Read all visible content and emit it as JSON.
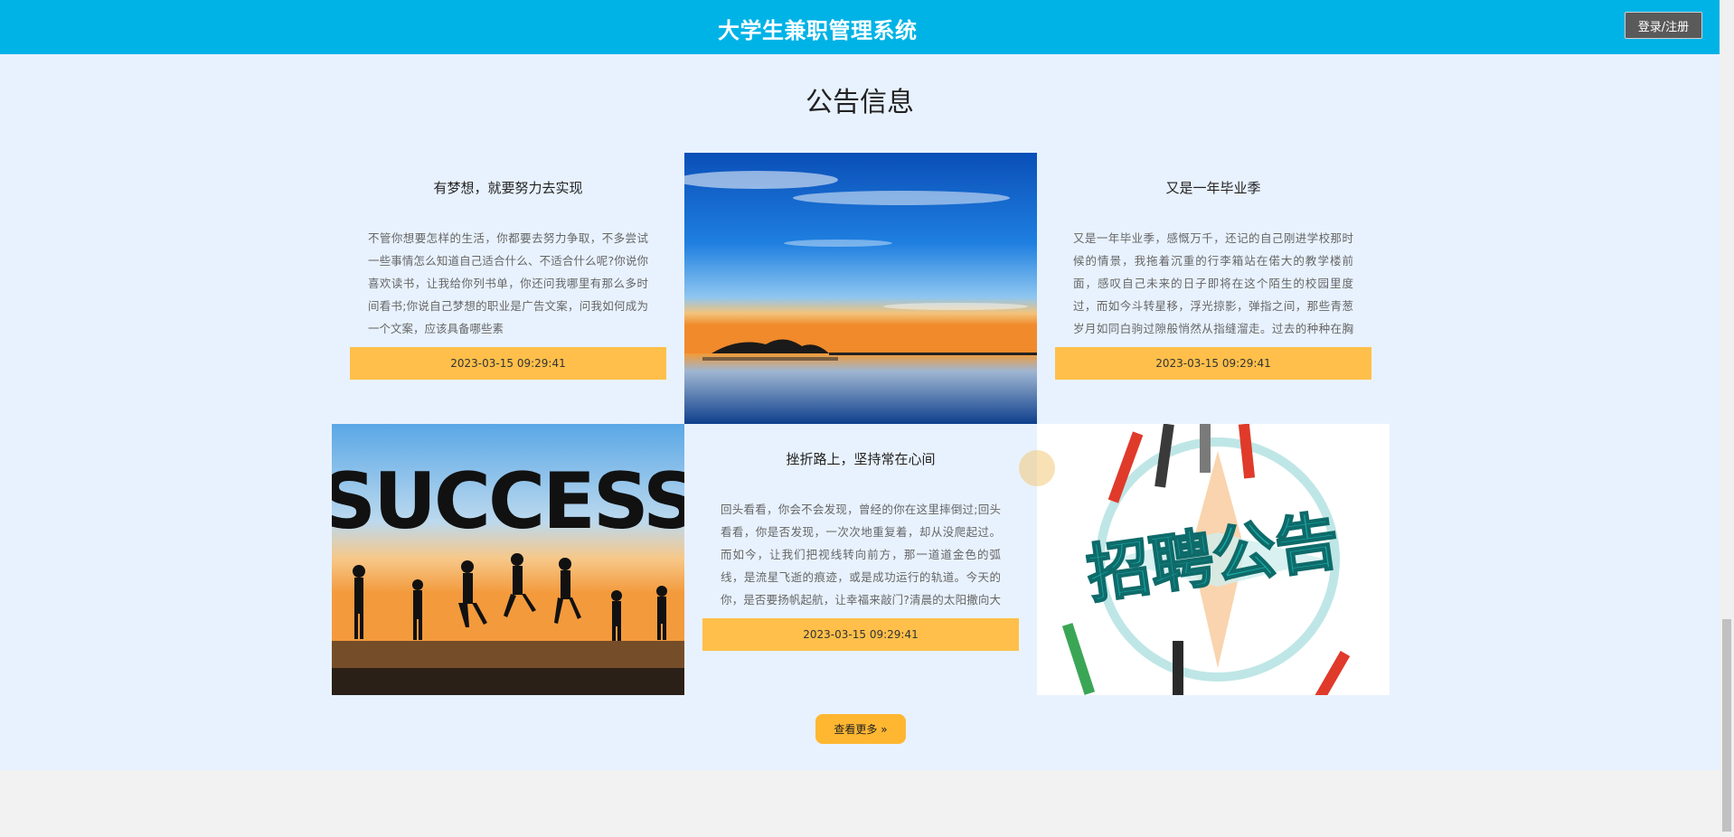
{
  "header": {
    "title": "大学生兼职管理系统",
    "login_label": "登录/注册"
  },
  "section": {
    "title": "公告信息",
    "more_label": "查看更多 »"
  },
  "cards": [
    {
      "title": "有梦想，就要努力去实现",
      "body": "不管你想要怎样的生活，你都要去努力争取，不多尝试一些事情怎么知道自己适合什么、不适合什么呢?你说你喜欢读书，让我给你列书单，你还问我哪里有那么多时间看书;你说自己梦想的职业是广告文案，问我如何成为一个文案，应该具备哪些素",
      "date": "2023-03-15 09:29:41"
    },
    {
      "title": "又是一年毕业季",
      "body": "又是一年毕业季，感慨万千，还记的自己刚进学校那时候的情景，我拖着沉重的行李箱站在偌大的教学楼前面，感叹自己未来的日子即将在这个陌生的校园里度过，而如今斗转星移，浮光掠影，弹指之间，那些青葱岁月如同白驹过隙般悄然从指缝溜走。过去的种种在胸口交集纠结，像",
      "date": "2023-03-15 09:29:41"
    },
    {
      "title": "挫折路上，坚持常在心间",
      "body": "回头看看，你会不会发现，曾经的你在这里摔倒过;回头看看，你是否发现，一次次地重复着，却从没爬起过。而如今，让我们把视线转向前方，那一道道金色的弧线，是流星飞逝的痕迹，或是成功运行的轨道。今天的你，是否要扬帆起航，让幸福来敲门?清晨的太阳撒向大地，神奇",
      "date": "2023-03-15 09:29:41"
    }
  ],
  "images": [
    {
      "icon": "sunset-lake-image"
    },
    {
      "icon": "success-silhouettes-image",
      "text": "SUCCESS"
    },
    {
      "icon": "recruitment-notice-image",
      "text": "招聘公告"
    }
  ]
}
